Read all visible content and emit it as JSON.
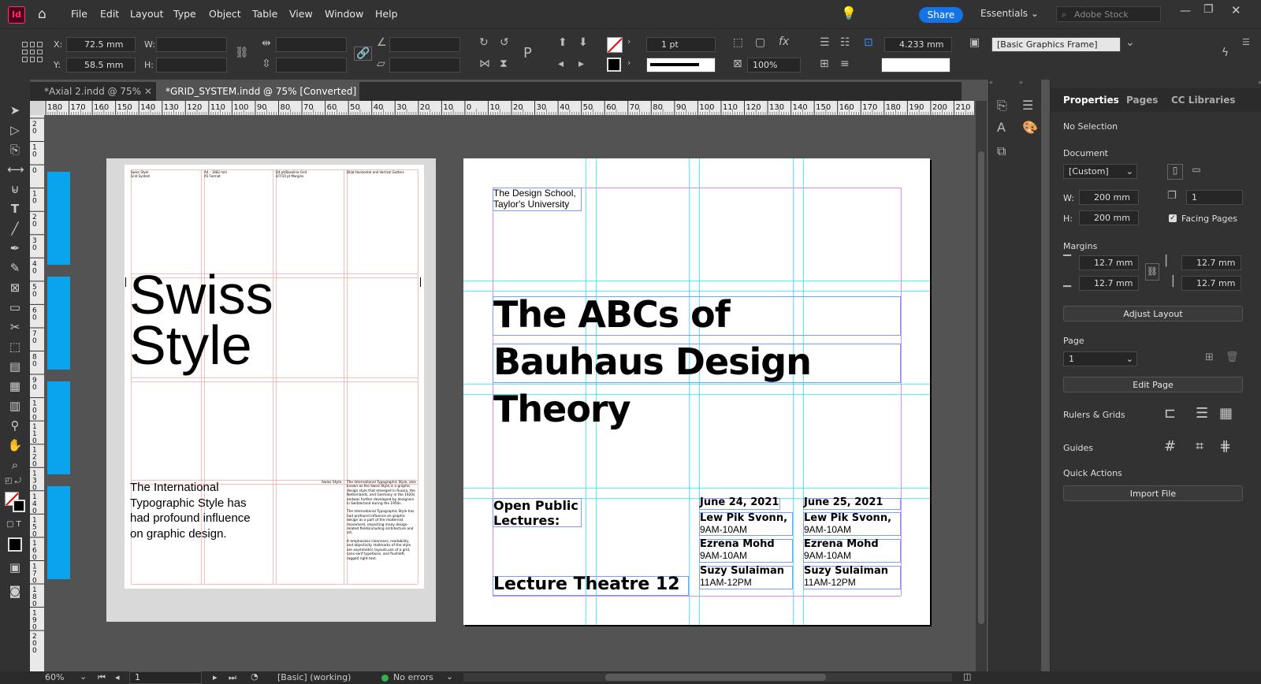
{
  "menubar": {
    "app_icon": "Id",
    "items": [
      "File",
      "Edit",
      "Layout",
      "Type",
      "Object",
      "Table",
      "View",
      "Window",
      "Help"
    ],
    "share_label": "Share",
    "workspace": "Essentials",
    "stock_placeholder": "Adobe Stock"
  },
  "controls": {
    "x_label": "X:",
    "x_value": "72.5 mm",
    "y_label": "Y:",
    "y_value": "58.5 mm",
    "w_label": "W:",
    "h_label": "H:",
    "stroke_weight": "1 pt",
    "opacity": "100%",
    "gutter": "4.233 mm",
    "object_style": "[Basic Graphics Frame]"
  },
  "tabs": [
    {
      "label": "*Axial 2.indd @ 75%"
    },
    {
      "label": "*GRID_SYSTEM.indd @ 75% [Converted]"
    }
  ],
  "ruler": {
    "h_ticks": [
      "180",
      "170",
      "160",
      "150",
      "140",
      "130",
      "120",
      "110",
      "100",
      "90",
      "80",
      "70",
      "60",
      "50",
      "40",
      "30",
      "20",
      "10",
      "0",
      "10",
      "20",
      "30",
      "40",
      "50",
      "60",
      "70",
      "80",
      "90",
      "100",
      "110",
      "120",
      "130",
      "140",
      "150",
      "160",
      "170",
      "180",
      "190",
      "200",
      "210"
    ],
    "v_ticks": [
      "2 0",
      "1 0",
      "0",
      "1 0",
      "2 0",
      "3 0",
      "4 0",
      "5 0",
      "6 0",
      "7 0",
      "8 0",
      "9 0",
      "1 0 0",
      "1 1 0",
      "1 2 0",
      "1 3 0",
      "1 4 0",
      "1 5 0",
      "1 6 0",
      "1 7 0",
      "1 8 0",
      "1 9 0",
      "2 0 0"
    ]
  },
  "left_page": {
    "meta": [
      "Swiss Style\nGrid System",
      "A4 – 1682 mm\nA5 Format",
      "D4 pt/Baseline Grid\n4/7/10 pt Margins",
      "DI/pt Horizontal and Vertical Gutters"
    ],
    "headline_1": "Swiss",
    "headline_2": "Style",
    "body_lines": [
      "The International",
      "Typographic Style has",
      "had profound influence",
      "on graphic design."
    ],
    "side_label": "Swiss Style",
    "column_text_1": "The International Typographic Style, also known as the Swiss Style,is a graphic design style that emerged in Russia, the Netherlands, and Germany in the 1920s andwas further developed by designers in Switzerland during the 1950s.",
    "column_text_2": "The International Typographic Style has had profound influence on graphic design as a part of the modernist movement, impacting many design-related fieldsincluding architecture and art.",
    "column_text_3": "It emphasizes cleanness, readability, and objectivity. Hallmarks of the style are asymmetric layouts,use of a grid, sans-serif typefaces, and flushleft, ragged right text."
  },
  "right_page": {
    "school_1": "The Design School,",
    "school_2": "Taylor's University",
    "title_1": "The ABCs of",
    "title_2": "Bauhaus Design Theory",
    "open_1": "Open Public",
    "open_2": "Lectures:",
    "venue": "Lecture Theatre 12",
    "schedule": [
      {
        "date": "June 24, 2021",
        "sessions": [
          {
            "name": "Lew Pik Svonn,",
            "time": "9AM-10AM"
          },
          {
            "name": "Ezrena Mohd",
            "time": "9AM-10AM"
          },
          {
            "name": "Suzy Sulaiman",
            "time": "11AM-12PM"
          }
        ]
      },
      {
        "date": "June 25, 2021",
        "sessions": [
          {
            "name": "Lew Pik Svonn,",
            "time": "9AM-10AM"
          },
          {
            "name": "Ezrena Mohd",
            "time": "9AM-10AM"
          },
          {
            "name": "Suzy Sulaiman",
            "time": "11AM-12PM"
          }
        ]
      }
    ]
  },
  "properties": {
    "tabs": [
      "Properties",
      "Pages",
      "CC Libraries"
    ],
    "selection": "No Selection",
    "document_label": "Document",
    "preset": "[Custom]",
    "w_label": "W:",
    "w_value": "200 mm",
    "h_label": "H:",
    "h_value": "200 mm",
    "pages_count": "1",
    "facing_pages": "Facing Pages",
    "margins_label": "Margins",
    "margin_top": "12.7 mm",
    "margin_bottom": "12.7 mm",
    "margin_left": "12.7 mm",
    "margin_right": "12.7 mm",
    "adjust_layout": "Adjust Layout",
    "page_label": "Page",
    "page_value": "1",
    "edit_page": "Edit Page",
    "rulers_grids": "Rulers & Grids",
    "guides": "Guides",
    "quick_actions": "Quick Actions",
    "import_file": "Import File"
  },
  "status": {
    "zoom": "60%",
    "page": "1",
    "style": "[Basic] (working)",
    "errors": "No errors"
  },
  "colors": {
    "accent": "#1473e6",
    "swatch_blue": "#0aa3ee",
    "ok": "#2fb34a"
  }
}
